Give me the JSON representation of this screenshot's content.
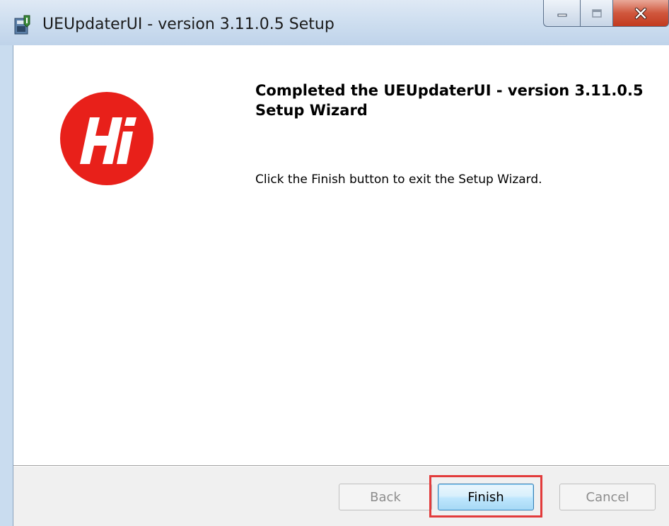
{
  "window": {
    "title": "UEUpdaterUI - version 3.11.0.5 Setup",
    "icon": "installer-icon"
  },
  "caption": {
    "minimize_icon": "minimize-icon",
    "maximize_icon": "maximize-icon",
    "close_icon": "close-icon"
  },
  "content": {
    "heading": "Completed the UEUpdaterUI - version 3.11.0.5 Setup Wizard",
    "message": "Click the Finish button to exit the Setup Wizard.",
    "logo_icon": "hi-logo-icon",
    "logo_color": "#e8201a"
  },
  "footer": {
    "back_label": "Back",
    "finish_label": "Finish",
    "cancel_label": "Cancel",
    "highlight_color": "#e23b3b"
  }
}
